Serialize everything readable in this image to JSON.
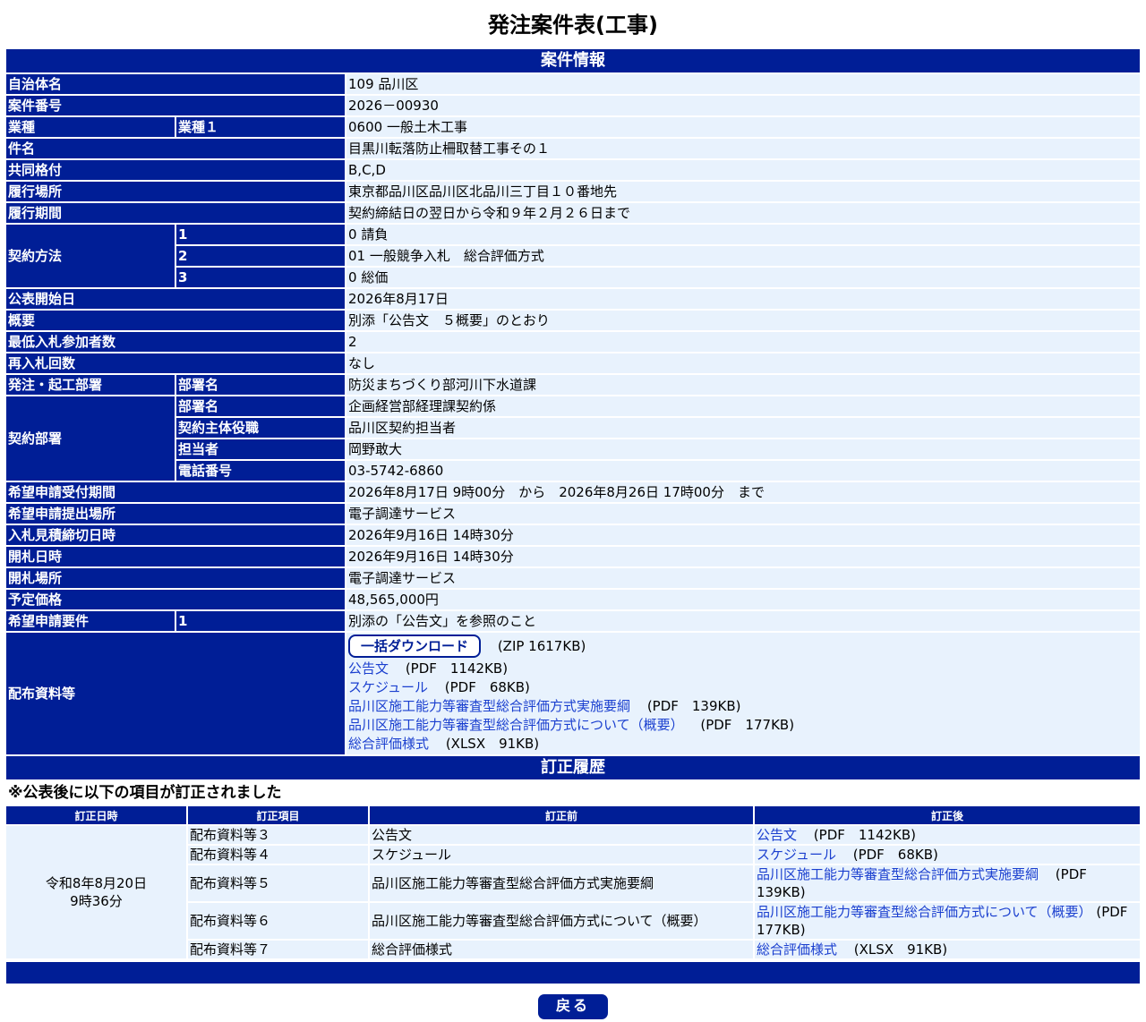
{
  "page_title": "発注案件表(工事)",
  "sections": {
    "info": "案件情報",
    "history": "訂正履歴"
  },
  "info": {
    "jichitai": {
      "label": "自治体名",
      "value": "109 品川区"
    },
    "anken_no": {
      "label": "案件番号",
      "value": "2026－00930"
    },
    "gyoshu": {
      "label": "業種",
      "sub": "業種１",
      "value": "0600 一般土木工事"
    },
    "kenmei": {
      "label": "件名",
      "value": "目黒川転落防止柵取替工事その１"
    },
    "kyodo": {
      "label": "共同格付",
      "value": "B,C,D"
    },
    "basho": {
      "label": "履行場所",
      "value": "東京都品川区品川区北品川三丁目１０番地先"
    },
    "kikan": {
      "label": "履行期間",
      "value": "契約締結日の翌日から令和９年２月２６日まで"
    },
    "keiyaku_hoho": {
      "label": "契約方法",
      "rows": [
        {
          "sub": "1",
          "value": "0 請負"
        },
        {
          "sub": "2",
          "value": "01 一般競争入札　総合評価方式"
        },
        {
          "sub": "3",
          "value": "0 総価"
        }
      ]
    },
    "kohyo": {
      "label": "公表開始日",
      "value": "2026年8月17日"
    },
    "gaiyo": {
      "label": "概要",
      "value": "別添「公告文　５概要」のとおり"
    },
    "saitei": {
      "label": "最低入札参加者数",
      "value": "2"
    },
    "sainyu": {
      "label": "再入札回数",
      "value": "なし"
    },
    "hatchu": {
      "label": "発注・起工部署",
      "sub": "部署名",
      "value": "防災まちづくり部河川下水道課"
    },
    "keiyaku_busho": {
      "label": "契約部署",
      "rows": [
        {
          "sub": "部署名",
          "value": "企画経営部経理課契約係"
        },
        {
          "sub": "契約主体役職",
          "value": "品川区契約担当者"
        },
        {
          "sub": "担当者",
          "value": "岡野敢大"
        },
        {
          "sub": "電話番号",
          "value": "03-5742-6860"
        }
      ]
    },
    "uketsuke": {
      "label": "希望申請受付期間",
      "value": "2026年8月17日 9時00分　から　2026年8月26日 17時00分　まで"
    },
    "teishutsu": {
      "label": "希望申請提出場所",
      "value": "電子調達サービス"
    },
    "shimekiri": {
      "label": "入札見積締切日時",
      "value": "2026年9月16日 14時30分"
    },
    "kaisatsu": {
      "label": "開札日時",
      "value": "2026年9月16日 14時30分"
    },
    "kaisatsu_basho": {
      "label": "開札場所",
      "value": "電子調達サービス"
    },
    "yotei": {
      "label": "予定価格",
      "value": "48,565,000円"
    },
    "yoken": {
      "label": "希望申請要件",
      "sub": "1",
      "value": "別添の「公告文」を参照のこと"
    },
    "haifu": {
      "label": "配布資料等",
      "download_label": "一括ダウンロード",
      "download_size": "(ZIP 1617KB)",
      "files": [
        {
          "name": "公告文",
          "size": "(PDF　1142KB)"
        },
        {
          "name": "スケジュール",
          "size": "(PDF　68KB)"
        },
        {
          "name": "品川区施工能力等審査型総合評価方式実施要綱",
          "size": "(PDF　139KB)"
        },
        {
          "name": "品川区施工能力等審査型総合評価方式について（概要）",
          "size": "(PDF　177KB)"
        },
        {
          "name": "総合評価様式",
          "size": "(XLSX　91KB)"
        }
      ]
    }
  },
  "history": {
    "note": "※公表後に以下の項目が訂正されました",
    "headers": [
      "訂正日時",
      "訂正項目",
      "訂正前",
      "訂正後"
    ],
    "date_line1": "令和8年8月20日",
    "date_line2": "9時36分",
    "rows": [
      {
        "item": "配布資料等３",
        "before": "公告文",
        "after_name": "公告文",
        "after_size": "(PDF　1142KB)"
      },
      {
        "item": "配布資料等４",
        "before": "スケジュール",
        "after_name": "スケジュール",
        "after_size": "(PDF　68KB)"
      },
      {
        "item": "配布資料等５",
        "before": "品川区施工能力等審査型総合評価方式実施要綱",
        "after_name": "品川区施工能力等審査型総合評価方式実施要綱",
        "after_size": "(PDF　139KB)"
      },
      {
        "item": "配布資料等６",
        "before": "品川区施工能力等審査型総合評価方式について（概要）",
        "after_name": "品川区施工能力等審査型総合評価方式について（概要）",
        "after_size": "(PDF　177KB)"
      },
      {
        "item": "配布資料等７",
        "before": "総合評価様式",
        "after_name": "総合評価様式",
        "after_size": "(XLSX　91KB)"
      }
    ]
  },
  "back_button": "戻る"
}
